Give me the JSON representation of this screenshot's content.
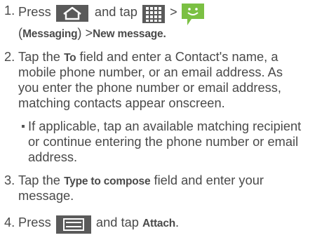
{
  "steps": [
    {
      "number": "1.",
      "press": "Press",
      "and_tap": "and tap",
      "gt": ">",
      "messaging": "Messaging",
      "open_paren": "(",
      "close_paren": ")",
      "gt2": ">",
      "new_message": "New message."
    },
    {
      "number": "2.",
      "tap": "Tap the",
      "to": "To",
      "l1_rest": "field and enter a Contact's name, a",
      "l2": "mobile phone number, or an email address. As",
      "l3": "you enter the phone number or email address,",
      "l4": "matching contacts appear onscreen."
    },
    {
      "sub_l1": "If applicable, tap an available matching recipient",
      "sub_l2": "or continue entering the phone number or email",
      "sub_l3": "address."
    },
    {
      "number": "3.",
      "tap": "Tap the",
      "type_to_compose": "Type to compose",
      "l1_rest": "field and enter your",
      "l2": "message."
    },
    {
      "number": "4.",
      "press": "Press",
      "and_tap": "and tap",
      "attach": "Attach",
      "period": "."
    }
  ],
  "icons": {
    "home": "home-icon",
    "apps": "apps-grid-icon",
    "messaging": "messaging-icon",
    "menu": "menu-icon"
  },
  "colors": {
    "text": "#4a4a4a",
    "icon_bg": "#5a5a5a",
    "messaging_green": "#7bc043"
  }
}
